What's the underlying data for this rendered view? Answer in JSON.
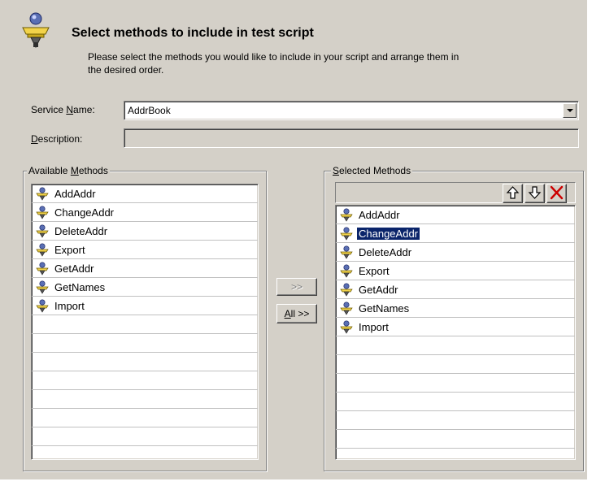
{
  "header": {
    "title": "Select methods to include in test script",
    "subtitle": "Please select the methods you would like to include in your script and arrange them in the desired order."
  },
  "service": {
    "label_prefix": "Service ",
    "label_key": "N",
    "label_suffix": "ame:",
    "value": "AddrBook"
  },
  "description": {
    "label_key": "D",
    "label_suffix": "escription:",
    "value": ""
  },
  "available": {
    "legend_prefix": "Available ",
    "legend_key": "M",
    "legend_suffix": "ethods",
    "items": [
      "AddAddr",
      "ChangeAddr",
      "DeleteAddr",
      "Export",
      "GetAddr",
      "GetNames",
      "Import"
    ]
  },
  "transfer": {
    "add_label": ">>",
    "add_all_key": "A",
    "add_all_rest": "ll >>"
  },
  "selected": {
    "legend_key": "S",
    "legend_suffix": "elected Methods",
    "items": [
      "AddAddr",
      "ChangeAddr",
      "DeleteAddr",
      "Export",
      "GetAddr",
      "GetNames",
      "Import"
    ],
    "selected_index": 1
  },
  "icons": {
    "header": "method-wizard-icon",
    "method": "method-icon",
    "move_up": "arrow-up-icon",
    "move_down": "arrow-down-icon",
    "remove": "delete-x-icon"
  },
  "colors": {
    "dialog_bg": "#d4d0c8",
    "selection_bg": "#0a246a",
    "remove_red": "#cc0000"
  }
}
